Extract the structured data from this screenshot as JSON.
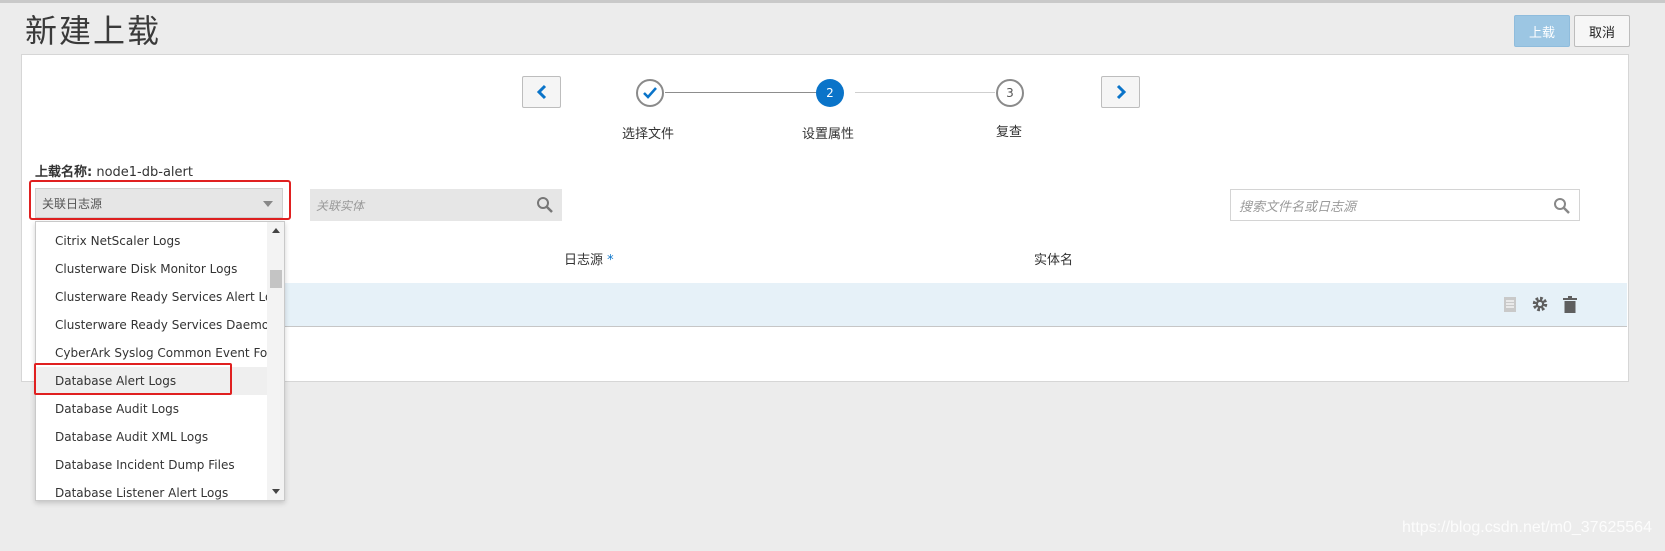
{
  "page": {
    "title": "新建上载"
  },
  "actions": {
    "upload_label": "上载",
    "cancel_label": "取消"
  },
  "wizard": {
    "steps": [
      {
        "label": "选择文件",
        "state": "done"
      },
      {
        "label": "设置属性",
        "number": "2",
        "state": "active"
      },
      {
        "label": "复查",
        "number": "3",
        "state": "pending"
      }
    ]
  },
  "upload": {
    "name_key": "上载名称:",
    "name_value": "node1-db-alert"
  },
  "filters": {
    "log_source_placeholder": "关联日志源",
    "entity_placeholder": "关联实体",
    "file_search_placeholder": "搜索文件名或日志源"
  },
  "table": {
    "columns": {
      "log_source": "日志源",
      "required_mark": "*",
      "entity": "实体名"
    }
  },
  "dropdown": {
    "items": [
      "Citrix NetScaler Logs",
      "Clusterware Disk Monitor Logs",
      "Clusterware Ready Services Alert Logs",
      "Clusterware Ready Services Daemon L...",
      "CyberArk Syslog Common Event For...",
      "Database Alert Logs",
      "Database Audit Logs",
      "Database Audit XML Logs",
      "Database Incident Dump Files",
      "Database Listener Alert Logs"
    ],
    "selected_index": 5
  },
  "colors": {
    "accent": "#0a74c9",
    "highlight": "#e02020",
    "row_bg": "#e6f1f8"
  },
  "watermark": "https://blog.csdn.net/m0_37625564"
}
